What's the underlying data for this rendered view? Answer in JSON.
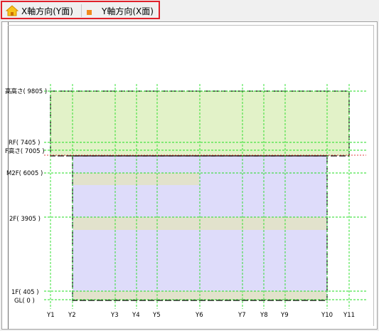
{
  "tabs": [
    {
      "label": "X軸方向(Y面)",
      "icon": "house-icon",
      "active": true
    },
    {
      "label": "Y軸方向(X面)",
      "icon": "orange-square-icon",
      "active": false
    }
  ],
  "levels": [
    {
      "label": "高高さ( 9805 )",
      "key": "top"
    },
    {
      "label": "RF( 7405 )",
      "key": "rf"
    },
    {
      "label": "F高さ( 7005 )",
      "key": "fh"
    },
    {
      "label": "M2F( 6005 )",
      "key": "m2f"
    },
    {
      "label": "2F( 3905 )",
      "key": "f2"
    },
    {
      "label": "1F( 405 )",
      "key": "f1"
    },
    {
      "label": "GL( 0 )",
      "key": "gl"
    }
  ],
  "axes": [
    "Y1",
    "Y2",
    "Y3",
    "Y4",
    "Y5",
    "Y6",
    "Y7",
    "Y8",
    "Y9",
    "Y10",
    "Y11"
  ],
  "colors": {
    "roof_fill": "#e2f2c8",
    "body_fill": "#dedcfa",
    "floor_band": "#e2e2cc",
    "grid_green": "#22dd22",
    "outline": "#000000",
    "tab_highlight": "#e0202a"
  }
}
